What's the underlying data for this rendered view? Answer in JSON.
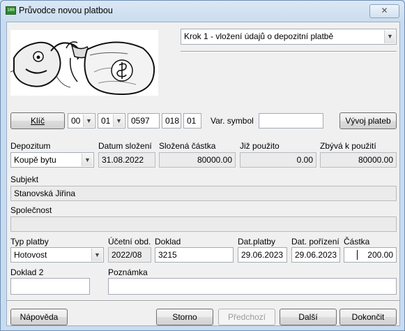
{
  "window": {
    "title": "Průvodce novou platbou",
    "close_glyph": "✕",
    "app_icon_text": "100"
  },
  "step_combo": {
    "value": "Krok 1 - vložení údajů o depozitní platbě"
  },
  "key": {
    "button_label": "Klíč",
    "part1": "00",
    "part2": "01",
    "part3": "0597",
    "part4": "018",
    "part5": "01",
    "var_symbol_label": "Var. symbol",
    "var_symbol_value": "",
    "history_button": "Vývoj plateb"
  },
  "deposit": {
    "depozitum_label": "Depozitum",
    "depozitum_value": "Koupě bytu",
    "date_label": "Datum složení",
    "date_value": "31.08.2022",
    "amount_label": "Složená částka",
    "amount_value": "80000.00",
    "used_label": "Již použito",
    "used_value": "0.00",
    "remaining_label": "Zbývá k použití",
    "remaining_value": "80000.00"
  },
  "subject": {
    "label": "Subjekt",
    "value": "Stanovská Jiřina"
  },
  "company": {
    "label": "Společnost",
    "value": ""
  },
  "payment": {
    "type_label": "Typ platby",
    "type_value": "Hotovost",
    "period_label": "Účetní obd.",
    "period_value": "2022/08",
    "doc_label": "Doklad",
    "doc_value": "3215",
    "pay_date_label": "Dat.platby",
    "pay_date_value": "29.06.2023",
    "acq_date_label": "Dat. pořízení",
    "acq_date_value": "29.06.2023",
    "sum_label": "Částka",
    "sum_value": "200.00"
  },
  "doc2": {
    "label": "Doklad 2",
    "value": ""
  },
  "note": {
    "label": "Poznámka",
    "value": ""
  },
  "footer": {
    "help": "Nápověda",
    "cancel": "Storno",
    "prev": "Předchozí",
    "next": "Další",
    "finish": "Dokončit"
  },
  "icons": {
    "combo_arrow": "chevron-down-icon",
    "image": "money-bag-illustration"
  }
}
